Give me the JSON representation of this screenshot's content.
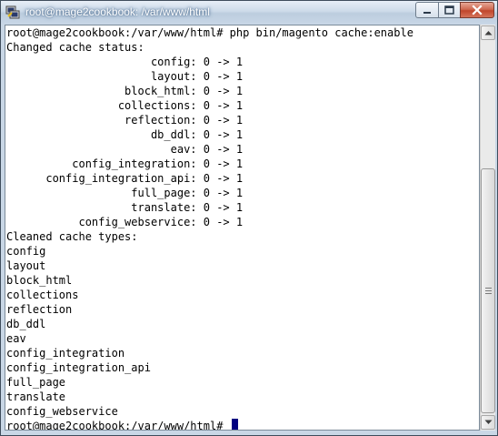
{
  "window": {
    "title": "root@mage2cookbook: /var/www/html",
    "icon": "putty-icon"
  },
  "controls": {
    "minimize_icon": "minimize-icon",
    "maximize_icon": "maximize-icon",
    "close_icon": "close-icon"
  },
  "terminal": {
    "lines": [
      "root@mage2cookbook:/var/www/html# php bin/magento cache:enable",
      "Changed cache status:",
      "                      config: 0 -> 1",
      "                      layout: 0 -> 1",
      "                  block_html: 0 -> 1",
      "                 collections: 0 -> 1",
      "                  reflection: 0 -> 1",
      "                      db_ddl: 0 -> 1",
      "                         eav: 0 -> 1",
      "          config_integration: 0 -> 1",
      "      config_integration_api: 0 -> 1",
      "                   full_page: 0 -> 1",
      "                   translate: 0 -> 1",
      "           config_webservice: 0 -> 1",
      "Cleaned cache types:",
      "config",
      "layout",
      "block_html",
      "collections",
      "reflection",
      "db_ddl",
      "eav",
      "config_integration",
      "config_integration_api",
      "full_page",
      "translate",
      "config_webservice"
    ],
    "prompt": "root@mage2cookbook:/var/www/html# "
  },
  "colors": {
    "terminal_background": "#ffffff",
    "terminal_text": "#000000",
    "cursor": "#000080",
    "titlebar": "#c9d7e6",
    "close_button": "#c0462c"
  }
}
